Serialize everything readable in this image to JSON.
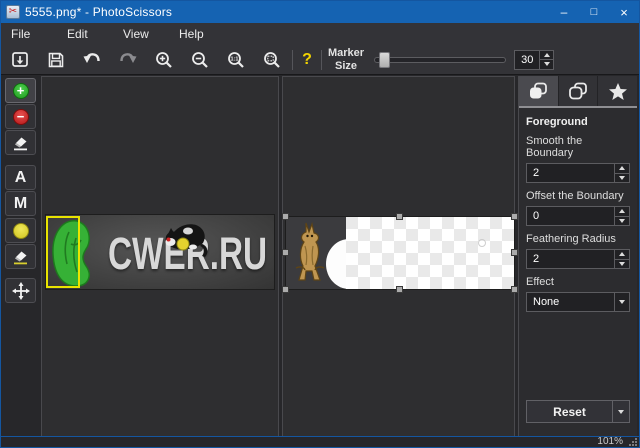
{
  "window": {
    "title": "5555.png* - PhotoScissors",
    "controls": {
      "minimize": "–",
      "maximize": "□",
      "close": "×"
    },
    "app_icon_glyph": "✂"
  },
  "menu": {
    "items": [
      {
        "label": "File"
      },
      {
        "label": "Edit"
      },
      {
        "label": "View"
      },
      {
        "label": "Help"
      }
    ]
  },
  "toolbar": {
    "icons": [
      "open-icon",
      "save-icon",
      "undo-icon",
      "redo-icon",
      "zoom-in-icon",
      "zoom-out-icon",
      "zoom-actual-icon",
      "zoom-fit-icon",
      "help-icon"
    ],
    "help_glyph": "?",
    "marker_size_label_line1": "Marker",
    "marker_size_label_line2": "Size",
    "marker_size_value": "30"
  },
  "tools": {
    "foreground_marker_glyph": "+",
    "background_marker_glyph": "−",
    "alpha_tool_label": "A",
    "mask_tool_label": "M"
  },
  "canvas": {
    "watermark_text": "CWER.RU"
  },
  "sidebar": {
    "tabs": [
      "foreground-tab",
      "background-tab",
      "effects-tab"
    ],
    "section_title": "Foreground",
    "smooth_label": "Smooth the Boundary",
    "smooth_value": "2",
    "offset_label": "Offset the Boundary",
    "offset_value": "0",
    "feather_label": "Feathering Radius",
    "feather_value": "2",
    "effect_label": "Effect",
    "effect_value": "None",
    "reset_label": "Reset"
  },
  "statusbar": {
    "zoom_level": "101%"
  },
  "colors": {
    "titlebar": "#1563b2",
    "foreground_marker": "#2fb32f",
    "background_marker": "#c32020",
    "yellow_marker": "#d9ce2e",
    "selection_yellow": "#e9e400",
    "help_yellow": "#f2d400"
  }
}
